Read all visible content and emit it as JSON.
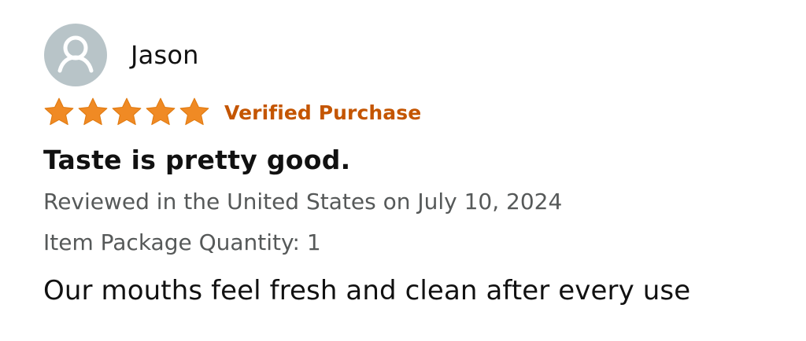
{
  "review": {
    "reviewer_name": "Jason",
    "avatar_icon": "user-profile-icon",
    "rating_value": 5,
    "rating_max": 5,
    "star_icon": "star-icon",
    "verified_label": "Verified Purchase",
    "title": "Taste is pretty good.",
    "date_line": "Reviewed in the United States on July 10, 2024",
    "package_quantity": "Item Package Quantity: 1",
    "body": "Our mouths feel fresh and clean after every use"
  },
  "colors": {
    "star": "#f08a24",
    "verified": "#c45500",
    "avatar_bg": "#b8c4c8",
    "muted_text": "#565959",
    "primary_text": "#111111"
  }
}
